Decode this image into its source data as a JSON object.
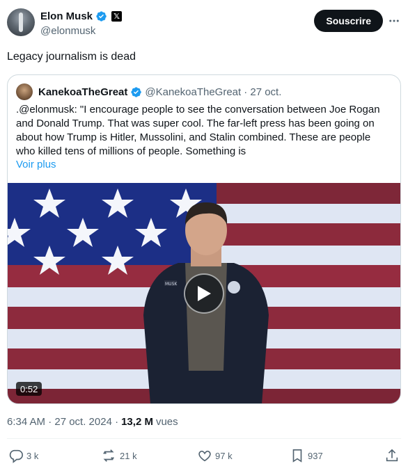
{
  "author": {
    "name": "Elon Musk",
    "handle": "@elonmusk",
    "verified_icon": "verified-badge-icon",
    "affiliation_icon": "x-logo-icon"
  },
  "header": {
    "subscribe_label": "Souscrire",
    "more_icon": "more-dots-icon"
  },
  "tweet": {
    "text": "Legacy journalism is dead"
  },
  "quote": {
    "name": "KanekoaTheGreat",
    "handle": "@KanekoaTheGreat",
    "date": "· 27 oct.",
    "text": ".@elonmusk: \"I encourage people to see the conversation between Joe Rogan and Donald Trump. That was super cool. The far-left press has been going on about how Trump is Hitler, Mussolini, and Stalin combined. These are people who killed tens of millions of people. Something is",
    "show_more": "Voir plus",
    "video": {
      "duration": "0:52",
      "jacket_label": "MUSK"
    }
  },
  "meta": {
    "time": "6:34 AM · 27 oct. 2024 ·",
    "views_count": "13,2 M",
    "views_label": "vues"
  },
  "actions": {
    "replies": "3 k",
    "reposts": "21 k",
    "likes": "97 k",
    "bookmarks": "937"
  },
  "colors": {
    "accent": "#1d9bf0",
    "text": "#0f1419",
    "secondary": "#536471",
    "border": "#cfd9de"
  }
}
